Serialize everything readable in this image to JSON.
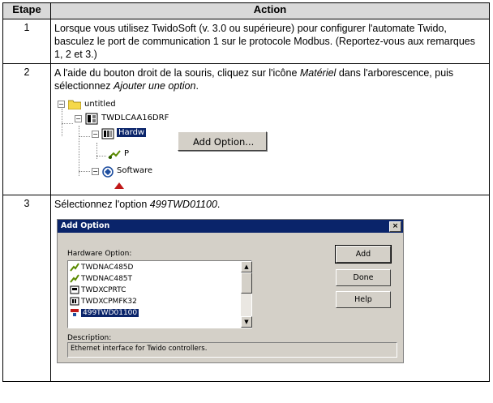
{
  "table": {
    "header_step": "Etape",
    "header_action": "Action"
  },
  "steps": [
    {
      "number": "1",
      "text": "Lorsque vous utilisez TwidoSoft (v. 3.0 ou supérieure) pour configurer l'automate Twido, basculez le port de communication 1 sur le protocole Modbus. (Reportez-vous aux remarques 1, 2 et 3.)"
    },
    {
      "number": "2",
      "text_pre": "A l'aide du bouton droit de la souris, cliquez sur l'icône ",
      "text_em1": "Matériel",
      "text_mid": " dans l'arborescence, puis sélectionnez ",
      "text_em2": "Ajouter une option",
      "text_post": "."
    },
    {
      "number": "3",
      "text_pre": "Sélectionnez l'option ",
      "text_em": "499TWD01100",
      "text_post": "."
    }
  ],
  "tree": {
    "root": "untitled",
    "controller": "TWDLCAA16DRF",
    "hardware": "Hardw",
    "port_partial": "P",
    "software": "Software",
    "context_menu_item": "Add Option..."
  },
  "dialog": {
    "title": "Add Option",
    "close_glyph": "×",
    "list_label": "Hardware Option:",
    "options": [
      "TWDNAC485D",
      "TWDNAC485T",
      "TWDXCPRTC",
      "TWDXCPMFK32",
      "499TWD01100"
    ],
    "selected_index": 4,
    "buttons": {
      "add": "Add",
      "done": "Done",
      "help": "Help"
    },
    "description_label": "Description:",
    "description_text": "Ethernet interface for Twido controllers."
  },
  "colors": {
    "selection": "#0a246a",
    "dialog_face": "#d4d0c8",
    "header_bg": "#d9d9d9"
  }
}
